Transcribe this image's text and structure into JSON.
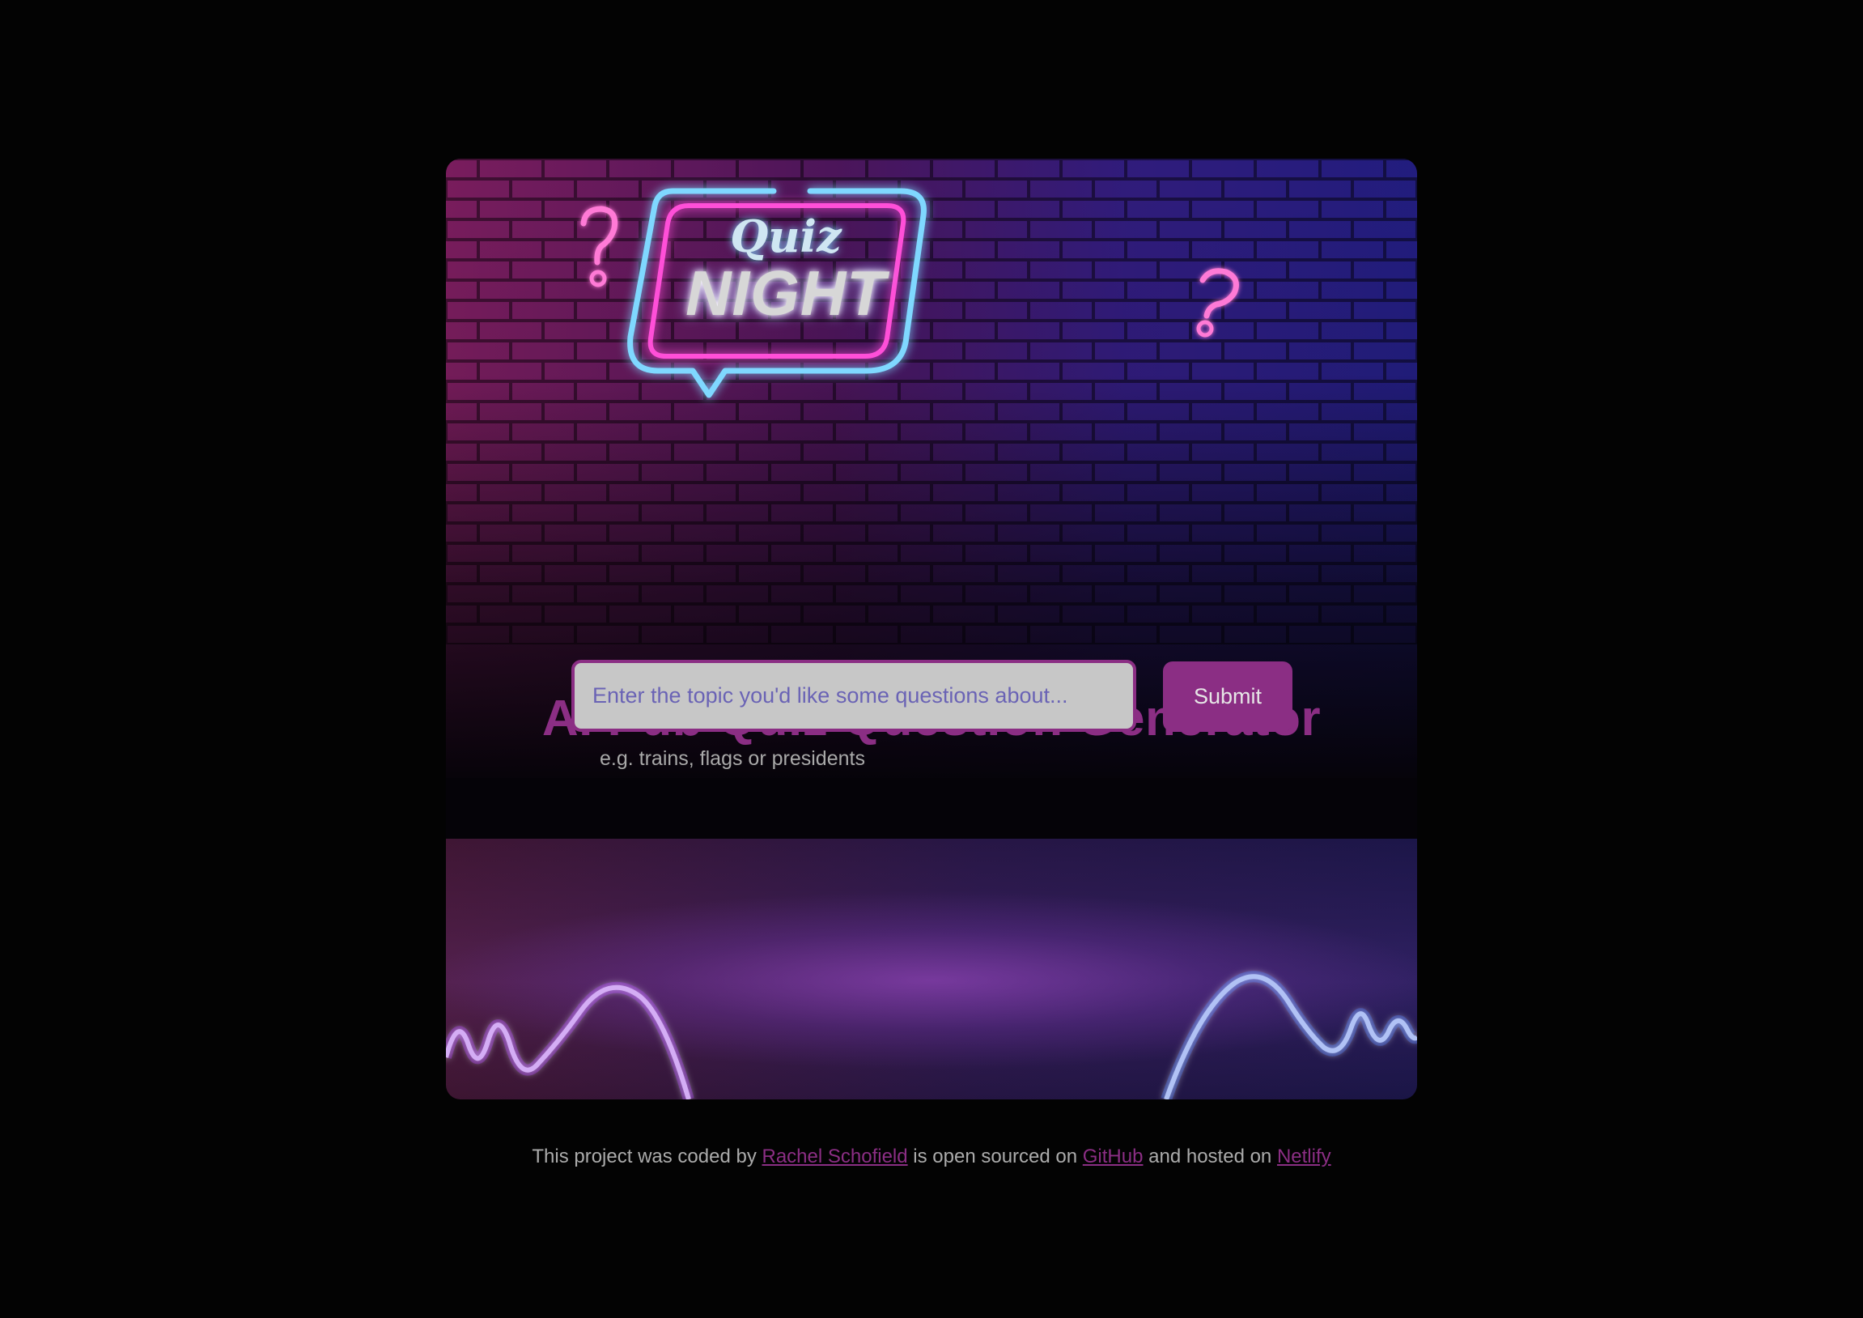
{
  "logo": {
    "line1": "Quiz",
    "line2": "NIGHT"
  },
  "title": "AI Pub Quiz Question Generator",
  "form": {
    "input_placeholder": "Enter the topic you'd like some questions about...",
    "input_value": "",
    "submit_label": "Submit",
    "hint": "e.g. trains, flags or presidents"
  },
  "footer": {
    "text_1": "This project was coded by",
    "author_link": "Rachel Schofield",
    "text_2": "is open sourced on",
    "github_link": "GitHub",
    "text_3": "and hosted on",
    "netlify_link": "Netlify"
  },
  "colors": {
    "accent": "#8b2e84",
    "input_text": "#6a63b5",
    "input_background": "#c7c7c7",
    "page_background": "#030303",
    "neon_cyan": "#7fd8ff",
    "neon_magenta": "#ff4fd8"
  },
  "icons": {
    "left_decoration": "question-mark-icon",
    "right_decoration": "question-mark-icon"
  }
}
